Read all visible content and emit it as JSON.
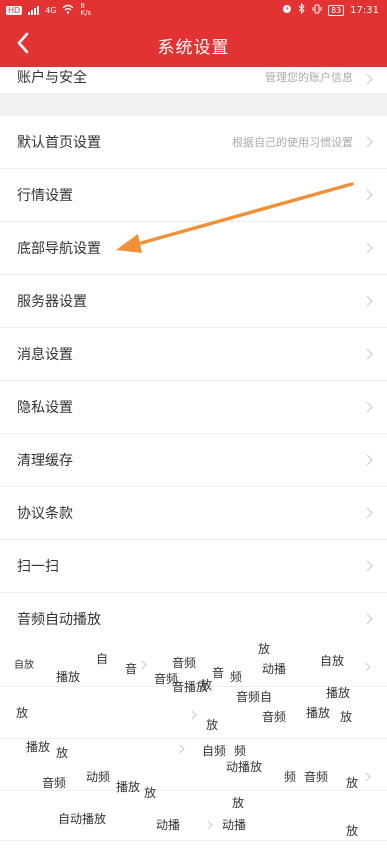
{
  "status_bar": {
    "left_label": "HD",
    "network": "4G",
    "speed": "8 K/s",
    "battery": "83",
    "time": "17:31"
  },
  "nav": {
    "title": "系统设置"
  },
  "list": {
    "account_label": "账户与安全",
    "account_hint": "管理您的账户信息",
    "home_label": "默认首页设置",
    "home_hint": "根据自己的使用习惯设置",
    "items": [
      "行情设置",
      "底部导航设置",
      "服务器设置",
      "消息设置",
      "隐私设置",
      "清理缓存",
      "协议条款",
      "扫一扫",
      "音频自动播放"
    ]
  },
  "scattered_text": [
    "自",
    "自放",
    "音",
    "音频",
    "放",
    "动播",
    "自放",
    "播放",
    "音频",
    "音",
    "频",
    "音频自",
    "播放",
    "音播放",
    "放",
    "放",
    "音频",
    "放",
    "放",
    "播放",
    "播放",
    "放",
    "自频",
    "频",
    "动播放",
    "音频",
    "动频",
    "播放",
    "放",
    "音频",
    "放",
    "频",
    "放",
    "自动播放",
    "动播",
    "动播",
    "放"
  ],
  "accent_color": "#e23232",
  "annotation_color": "#f0913a"
}
